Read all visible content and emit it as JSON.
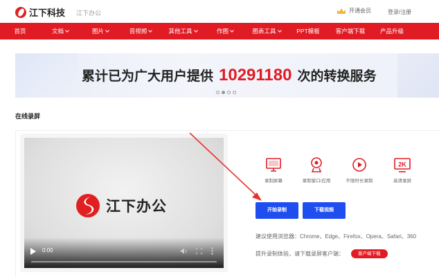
{
  "header": {
    "logo_text": "江下科技",
    "logo_sub": "江下办公",
    "vip_label": "开通会员",
    "login_links": "登录/注册"
  },
  "nav": {
    "items": [
      {
        "label": "首页",
        "has_caret": false
      },
      {
        "label": "文档",
        "has_caret": true
      },
      {
        "label": "图片",
        "has_caret": true
      },
      {
        "label": "音视频",
        "has_caret": true
      },
      {
        "label": "其他工具",
        "has_caret": true
      },
      {
        "label": "作图",
        "has_caret": true
      },
      {
        "label": "图表工具",
        "has_caret": true
      },
      {
        "label": "PPT模板",
        "has_caret": false
      },
      {
        "label": "客户端下载",
        "has_caret": false
      },
      {
        "label": "产品升级",
        "has_caret": false
      }
    ],
    "color": "#e01b24"
  },
  "banner": {
    "prefix": "累计已为广大用户提供",
    "number": "10291180",
    "suffix": "次的转换服务",
    "slides": 4,
    "active_slide": 2
  },
  "section": {
    "title": "在线录屏"
  },
  "video": {
    "brand_text": "江下办公",
    "time": "0:00"
  },
  "features": [
    {
      "label": "录制屏幕",
      "icon": "monitor-icon"
    },
    {
      "label": "录制窗口/应用",
      "icon": "webcam-icon"
    },
    {
      "label": "不限时长录制",
      "icon": "play-circle-icon"
    },
    {
      "label": "高清录屏",
      "icon": "2k-icon"
    }
  ],
  "buttons": {
    "start": "开始录制",
    "download": "下载视频"
  },
  "browsers_text": "建议使用浏览器：Chrome、Edge、Firefox、Opera、Safari、360",
  "upgrade": {
    "text": "提升录制体验，请下载录屏客户端：",
    "client_button": "客户端下载"
  },
  "colors": {
    "brand_red": "#e01b24",
    "primary_blue": "#1f4ef0"
  }
}
